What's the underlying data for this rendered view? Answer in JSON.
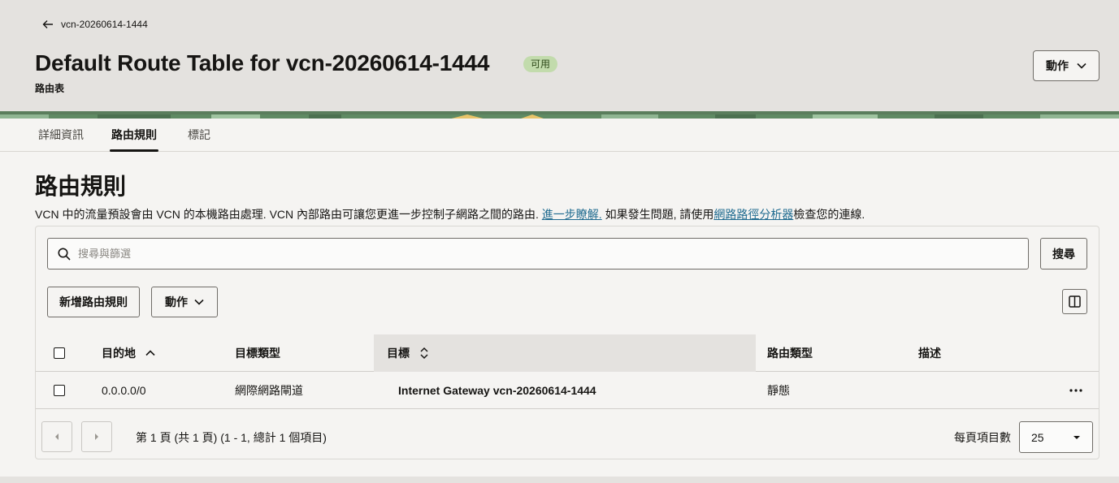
{
  "header": {
    "back_label": "vcn-20260614-1444",
    "title": "Default Route Table for vcn-20260614-1444",
    "status": "可用",
    "subtitle": "路由表",
    "actions_label": "動作"
  },
  "tabs": [
    {
      "label": "詳細資訊",
      "active": false
    },
    {
      "label": "路由規則",
      "active": true
    },
    {
      "label": "標記",
      "active": false
    }
  ],
  "section": {
    "title": "路由規則",
    "description_pre": "VCN 中的流量預設會由 VCN 的本機路由處理. VCN 內部路由可讓您更進一步控制子網路之間的路由. ",
    "learn_more_link": "進一步瞭解.",
    "description_mid": " 如果發生問題, 請使用",
    "analyzer_link": "網路路徑分析器",
    "description_post": "檢查您的連線."
  },
  "search": {
    "placeholder": "搜尋與篩選",
    "button_label": "搜尋"
  },
  "toolbar": {
    "add_label": "新增路由規則",
    "actions_label": "動作"
  },
  "table": {
    "columns": {
      "destination": "目的地",
      "target_type": "目標類型",
      "target": "目標",
      "route_type": "路由類型",
      "description": "描述"
    },
    "rows": [
      {
        "destination": "0.0.0.0/0",
        "target_type": "網際網路閘道",
        "target": "Internet Gateway vcn-20260614-1444",
        "route_type": "靜態",
        "description": ""
      }
    ]
  },
  "pagination": {
    "summary": "第 1 頁 (共 1 頁) (1 - 1, 總計 1 個項目)",
    "per_page_label": "每頁項目數",
    "per_page_value": "25"
  },
  "colors": {
    "header_bg": "#e4e2df",
    "page_bg": "#f5f4f2",
    "badge_bg": "#c2dbac",
    "link": "#1e6a8f"
  }
}
